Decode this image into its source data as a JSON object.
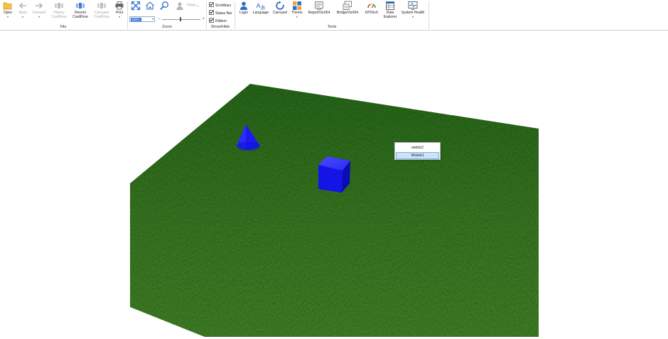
{
  "ribbon": {
    "groups": {
      "file": "File",
      "zoom": "Zoom",
      "show_hide": "Show/Hide",
      "tools": "Tools"
    },
    "file": {
      "open": "Open",
      "back": "Back",
      "forward": "Forward",
      "history_line1": "History",
      "history_line2": "CardFlow",
      "recent_line1": "Recent",
      "recent_line2": "CardFlow",
      "carousel_line1": "Carousel",
      "carousel_line2": "CardFlow",
      "print": "Print"
    },
    "zoom": {
      "views": "Views",
      "zoom_value": "100%",
      "minus": "−",
      "plus": "+"
    },
    "show_hide": {
      "scrollbars": "Scrollbars",
      "status_bar": "Status Bar",
      "ribbon": "Ribbon"
    },
    "tools": {
      "login": "Login",
      "language": "Language",
      "carousel": "Carousel",
      "theme": "Theme",
      "reportvisx64": "ReportVisX64",
      "bridgevisx64": "BridgeVisX64",
      "kpivisx": "KPIVisX",
      "data_explorer_line1": "Data",
      "data_explorer_line2": "Explorer",
      "system_health": "System Health"
    }
  },
  "popup": {
    "items": [
      "widok2",
      "Widok1"
    ],
    "selected_index": 1
  },
  "colors": {
    "accent": "#3b78d8",
    "grass": "#2f6b1e",
    "objects": "#1414e6"
  }
}
